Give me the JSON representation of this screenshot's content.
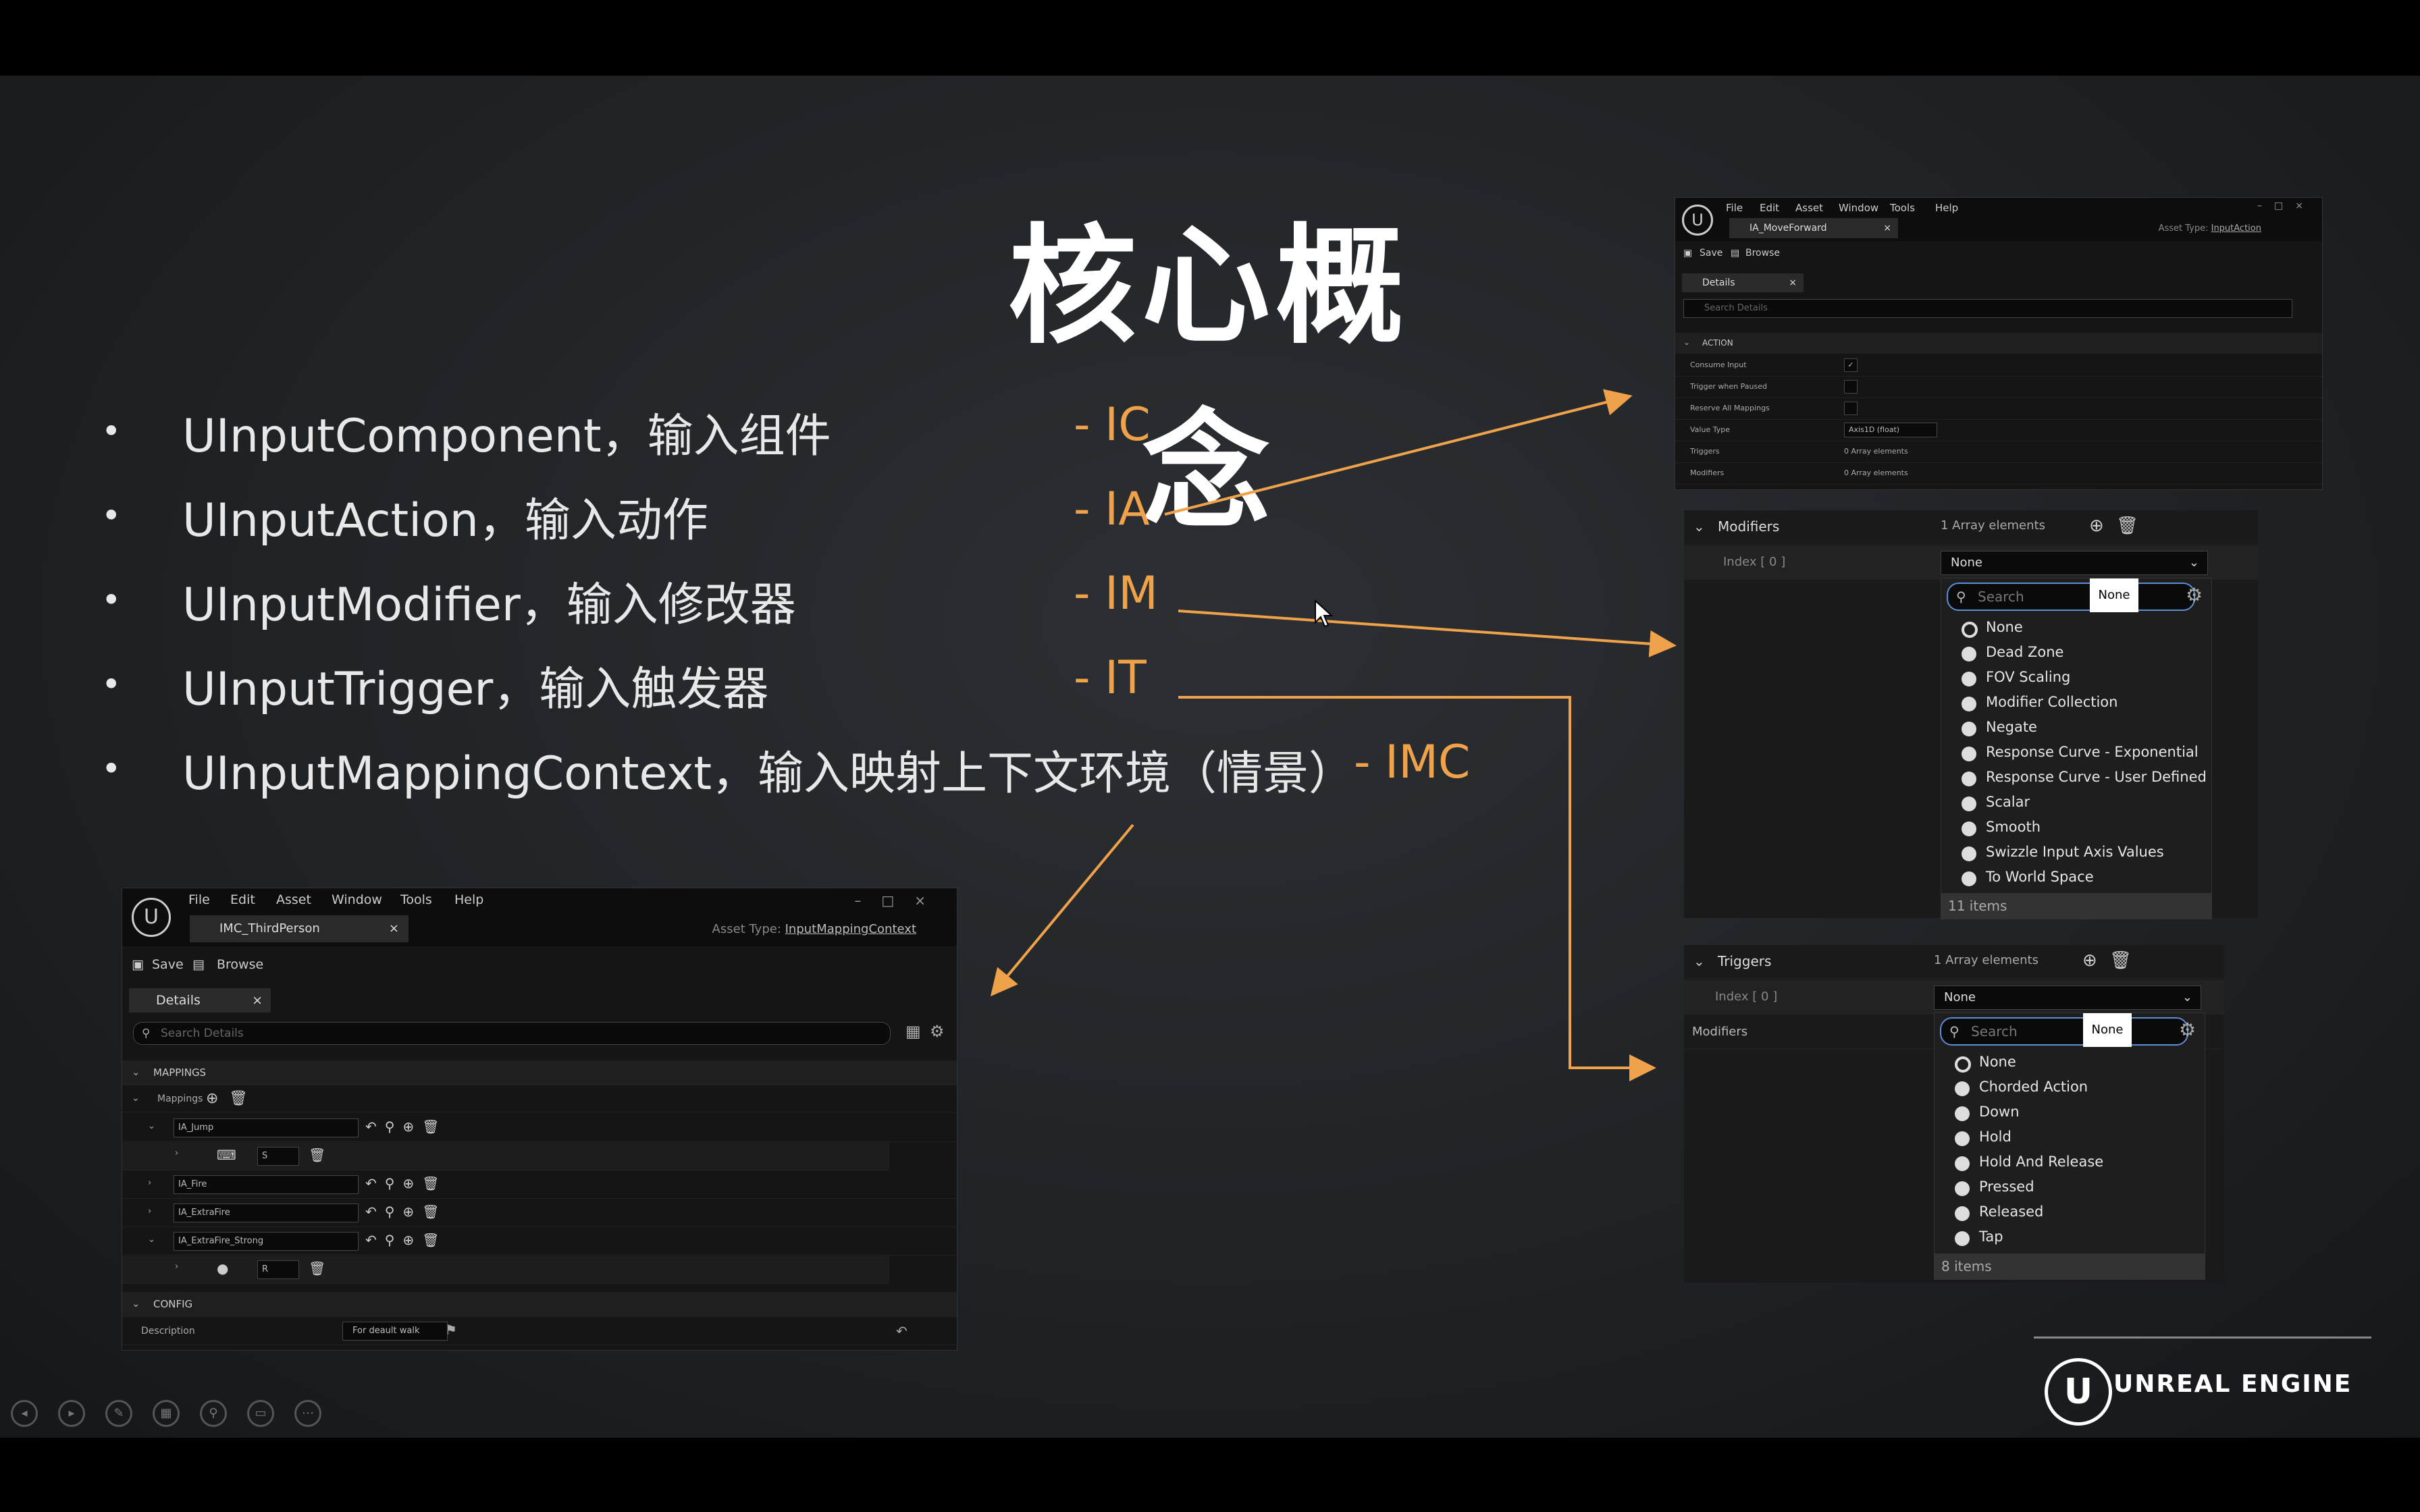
{
  "slide": {
    "title": "核心概念",
    "bullets": [
      {
        "text": "UInputComponent，输入组件",
        "abbr": "- IC"
      },
      {
        "text": "UInputAction，输入动作",
        "abbr": "- IA"
      },
      {
        "text": "UInputModifier，输入修改器",
        "abbr": "- IM"
      },
      {
        "text": "UInputTrigger，输入触发器",
        "abbr": "- IT"
      },
      {
        "text": "UInputMappingContext，输入映射上下文环境（情景）",
        "abbr": "- IMC"
      }
    ],
    "brand": "UNREAL ENGINE"
  },
  "ia_window": {
    "menu": [
      "File",
      "Edit",
      "Asset",
      "Window",
      "Tools",
      "Help"
    ],
    "tab": "IA_MoveForward",
    "asset_type_label": "Asset Type:",
    "asset_type": "InputAction",
    "save": "Save",
    "browse": "Browse",
    "details_tab": "Details",
    "search_placeholder": "Search Details",
    "section": "ACTION",
    "props": [
      {
        "label": "Consume Input",
        "value": "✓"
      },
      {
        "label": "Trigger when Paused",
        "value": ""
      },
      {
        "label": "Reserve All Mappings",
        "value": ""
      },
      {
        "label": "Value Type",
        "value": "Axis1D (float)"
      },
      {
        "label": "Triggers",
        "value": "0 Array elements"
      },
      {
        "label": "Modifiers",
        "value": "0 Array elements"
      }
    ]
  },
  "modifiers_panel": {
    "header": "Modifiers",
    "count": "1 Array elements",
    "index": "Index [ 0 ]",
    "selected": "None",
    "search_placeholder": "Search",
    "tooltip": "None",
    "options": [
      "None",
      "Dead Zone",
      "FOV Scaling",
      "Modifier Collection",
      "Negate",
      "Response Curve - Exponential",
      "Response Curve - User Defined",
      "Scalar",
      "Smooth",
      "Swizzle Input Axis Values",
      "To World Space"
    ],
    "footer": "11 items"
  },
  "triggers_panel": {
    "header": "Triggers",
    "count": "1 Array elements",
    "index": "Index [ 0 ]",
    "modifiers_label": "Modifiers",
    "selected": "None",
    "search_placeholder": "Search",
    "tooltip": "None",
    "options": [
      "None",
      "Chorded Action",
      "Down",
      "Hold",
      "Hold And Release",
      "Pressed",
      "Released",
      "Tap"
    ],
    "footer": "8 items"
  },
  "imc_window": {
    "menu": [
      "File",
      "Edit",
      "Asset",
      "Window",
      "Tools",
      "Help"
    ],
    "tab": "IMC_ThirdPerson",
    "asset_type_label": "Asset Type:",
    "asset_type": "InputMappingContext",
    "save": "Save",
    "browse": "Browse",
    "details_tab": "Details",
    "search_placeholder": "Search Details",
    "section_mappings": "MAPPINGS",
    "mappings_label": "Mappings",
    "mappings": [
      "IA_Jump",
      "IA_Fire",
      "IA_ExtraFire",
      "IA_ExtraFire_Strong"
    ],
    "key_values": [
      "S",
      "R"
    ],
    "section_config": "CONFIG",
    "description_label": "Description",
    "description_value": "For deault walk"
  },
  "colors": {
    "accent": "#f0a24a",
    "title": "#ffffff",
    "bg": "#202326"
  }
}
